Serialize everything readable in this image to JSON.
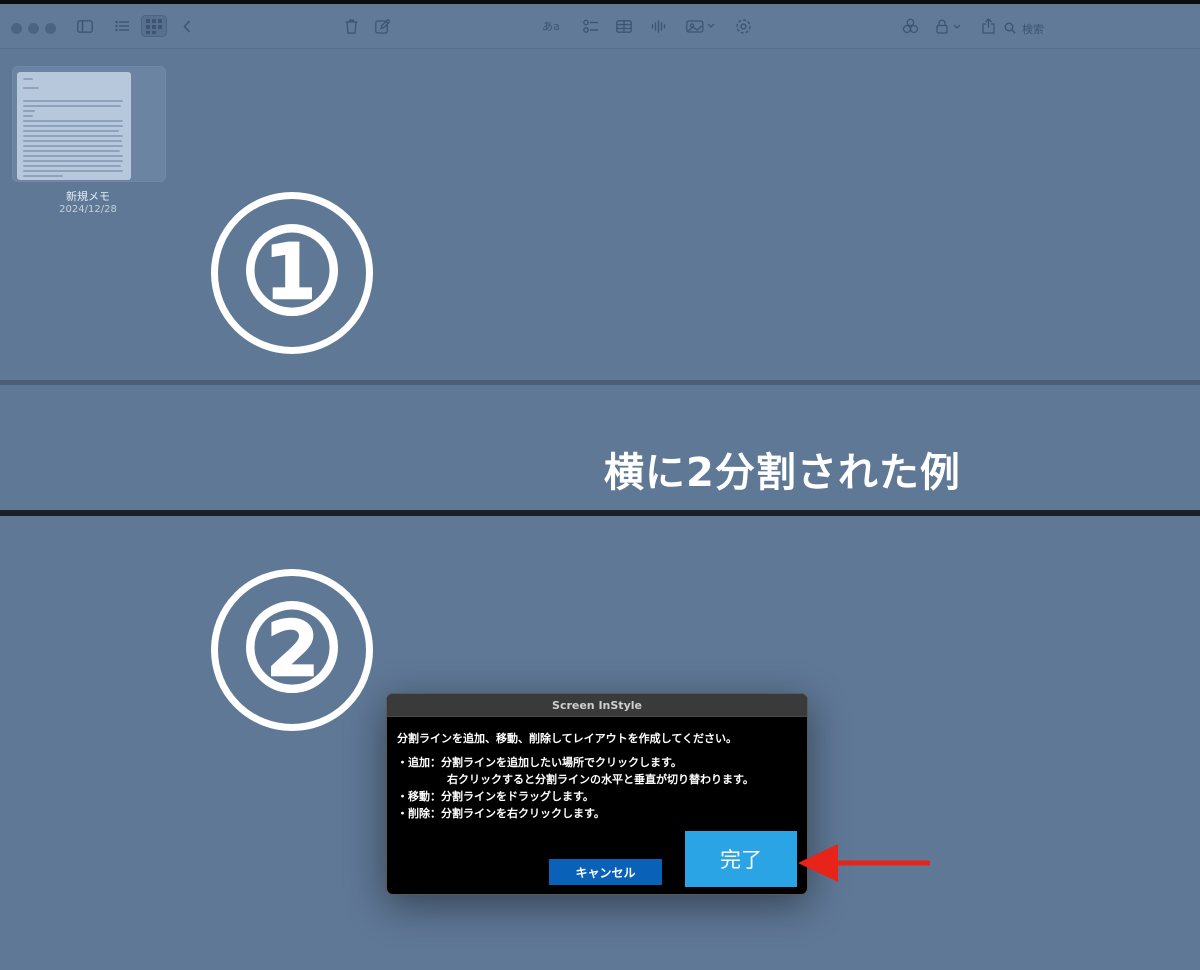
{
  "toolbar": {
    "icons": [
      "close-dot",
      "minimize-dot",
      "zoom-dot",
      "sidebar-icon",
      "list-view-icon",
      "gallery-view-icon",
      "back-chevron-icon",
      "trash-icon",
      "compose-icon",
      "format-icon",
      "checklist-icon",
      "table-icon",
      "audio-icon",
      "media-icon",
      "collaborate-icon",
      "link-icon",
      "lock-icon",
      "share-icon",
      "search-icon"
    ],
    "format_label": "あa",
    "search_placeholder": "検索"
  },
  "note": {
    "title": "新規メモ",
    "date": "2024/12/28"
  },
  "overlay": {
    "region_1": "①",
    "region_2": "②",
    "band_label": "横に2分割された例"
  },
  "dialog": {
    "title": "Screen InStyle",
    "intro": "分割ラインを追加、移動、削除してレイアウトを作成してください。",
    "add_line": "・追加：分割ラインを追加したい場所でクリックします。",
    "add_line_2": "右クリックすると分割ラインの水平と垂直が切り替わります。",
    "move_line": "・移動：分割ラインをドラッグします。",
    "delete_line": "・削除：分割ラインを右クリックします。",
    "cancel_label": "キャンセル",
    "done_label": "完了"
  },
  "colors": {
    "background": "#5f7896",
    "cancel_button": "#0a62b8",
    "done_button": "#2aa4e4",
    "arrow": "#e8231a"
  }
}
